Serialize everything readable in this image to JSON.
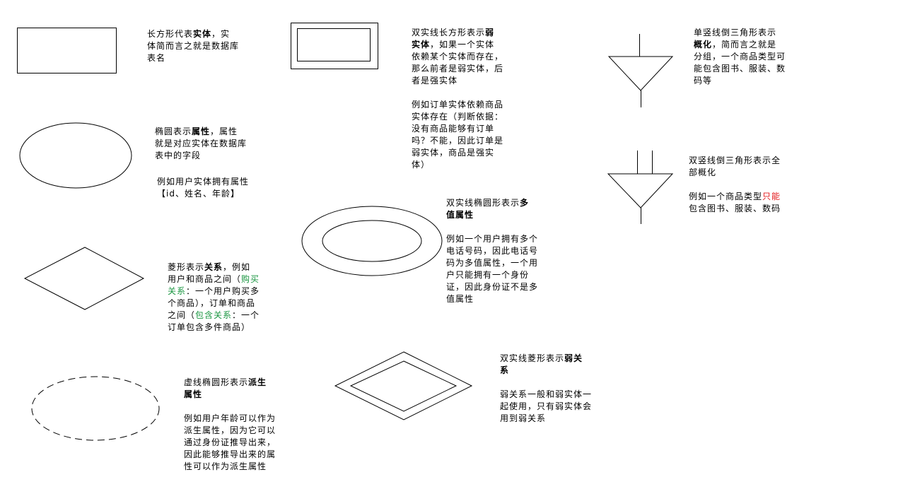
{
  "colors": {
    "stroke": "#000000",
    "green": "#1a9641",
    "red": "#e31a1c",
    "background": "#ffffff"
  },
  "notes": {
    "entity": {
      "l1_pre": "长方形代表",
      "l1_bold": "实体",
      "l1_post": "，实",
      "l2": "体简而言之就是数据库",
      "l3": "表名"
    },
    "weak_entity": {
      "l1_pre": "双实线长方形表示",
      "l1_bold": "弱",
      "l2_bold": "实体",
      "l2_post": "，如果一个实体",
      "l3": "依赖某个实体而存在，",
      "l4": "那么前者是弱实体，后",
      "l5": "者是强实体",
      "l6": "例如订单实体依赖商品",
      "l7": "实体存在（判断依据：",
      "l8": "没有商品能够有订单",
      "l9": "吗？不能，因此订单是",
      "l10": "弱实体，商品是强实",
      "l11": "体）"
    },
    "generalization": {
      "l1": "单竖线倒三角形表示",
      "l2_bold": "概化",
      "l2_post": "，简而言之就是",
      "l3": "分组，一个商品类型可",
      "l4": "能包含图书、服装、数",
      "l5": "码等"
    },
    "attribute": {
      "l1_pre": "椭圆表示",
      "l1_bold": "属性",
      "l1_post": "，属性",
      "l2": "就是对应实体在数据库",
      "l3": "表中的字段",
      "l4": "例如用户实体拥有属性",
      "l5": "【id、姓名、年龄】"
    },
    "total_generalization": {
      "l1": "双竖线倒三角形表示全",
      "l2": "部概化",
      "l3_pre": "例如一个商品类型",
      "l3_red": "只能",
      "l4": "包含图书、服装、数码"
    },
    "multivalued": {
      "l1_pre": "双实线椭圆形表示",
      "l1_bold": "多",
      "l2_bold": "值属性",
      "l3": "例如一个用户拥有多个",
      "l4": "电话号码，因此电话号",
      "l5": "码为多值属性，一个用",
      "l6": "户只能拥有一个身份",
      "l7": "证，因此身份证不是多",
      "l8": "值属性"
    },
    "relationship": {
      "l1_pre": "菱形表示",
      "l1_bold": "关系",
      "l1_post": "，例如",
      "l2_pre": "用户和商品之间（",
      "l2_green": "购买",
      "l3_green": "关系",
      "l3_post": "：一个用户购买多",
      "l4": "个商品），订单和商品",
      "l5": "之间（",
      "l5_green": "包含关系",
      "l5_post": "：一个",
      "l6": "订单包含多件商品）"
    },
    "weak_relationship": {
      "l1_pre": "双实线菱形表示",
      "l1_bold": "弱关",
      "l2_bold": "系",
      "l3": "弱关系一般和弱实体一",
      "l4": "起使用，只有弱实体会",
      "l5": "用到弱关系"
    },
    "derived": {
      "l1_pre": "虚线椭圆形表示",
      "l1_bold": "派生",
      "l2_bold": "属性",
      "l3": "例如用户年龄可以作为",
      "l4": "派生属性，因为它可以",
      "l5": "通过身份证推导出来，",
      "l6": "因此能够推导出来的属",
      "l7": "性可以作为派生属性"
    }
  }
}
